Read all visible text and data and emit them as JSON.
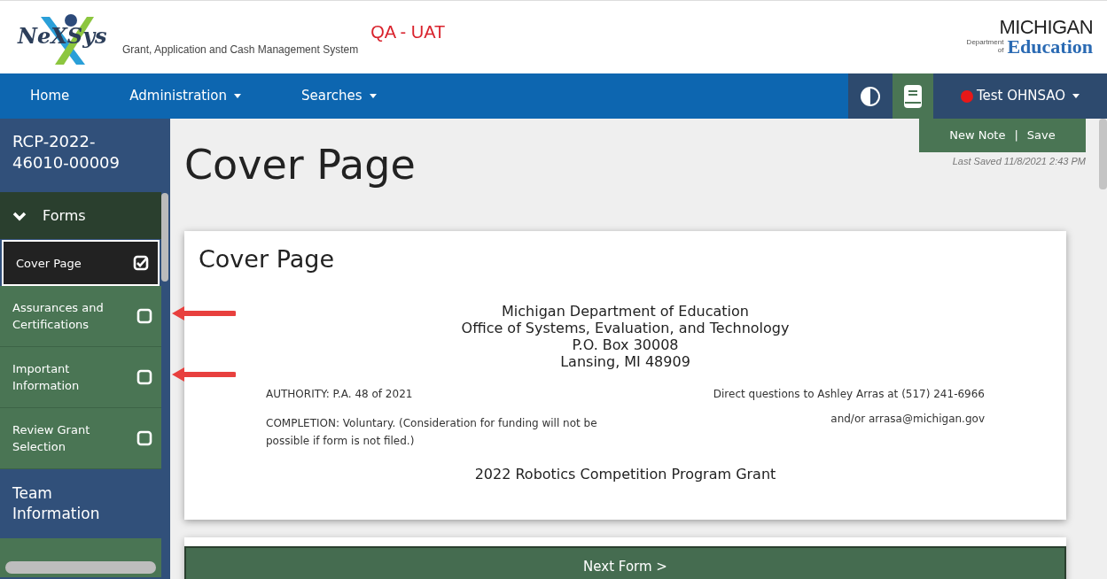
{
  "header": {
    "logo_text": "NeXSys",
    "subtitle": "Grant, Application and Cash Management System",
    "environment": "QA - UAT",
    "agency_logo": {
      "line_1": "MICHIGAN",
      "line_2_small": "Department of",
      "line_2": "Education"
    }
  },
  "nav": {
    "items": [
      {
        "label": "Home",
        "dropdown": false
      },
      {
        "label": "Administration",
        "dropdown": true
      },
      {
        "label": "Searches",
        "dropdown": true
      }
    ],
    "user": {
      "name": "Test OHNSAO"
    }
  },
  "sidebar": {
    "record_id": "RCP-2022-46010-00009",
    "section": {
      "label": "Forms",
      "expanded": true
    },
    "items": [
      {
        "kind": "form",
        "label": "Cover Page",
        "selected": true,
        "checked": true
      },
      {
        "kind": "form",
        "label": "Assurances and Certifications",
        "selected": false,
        "checked": false,
        "annotated": true
      },
      {
        "kind": "form",
        "label": "Important Information",
        "selected": false,
        "checked": false,
        "annotated": true
      },
      {
        "kind": "form",
        "label": "Review Grant Selection",
        "selected": false,
        "checked": false
      },
      {
        "kind": "section",
        "label": "Team Information",
        "selected": false
      },
      {
        "kind": "cut",
        "selected": false
      }
    ]
  },
  "actions": {
    "buttons": [
      "New Note",
      "Save"
    ],
    "separator": "|",
    "last_saved": "Last Saved 11/8/2021 2:43 PM"
  },
  "page_title": "Cover Page",
  "card": {
    "title": "Cover Page",
    "address": [
      "Michigan Department of Education",
      "Office of Systems, Evaluation, and Technology",
      "P.O. Box 30008",
      "Lansing, MI 48909"
    ],
    "authority": "AUTHORITY: P.A. 48 of 2021",
    "contact": "Direct questions to Ashley Arras at (517) 241-6966",
    "completion": "COMPLETION: Voluntary. (Consideration for funding will not be possible if form is not filed.)",
    "email": "and/or arrasa@michigan.gov",
    "program": "2022 Robotics Competition Program Grant"
  },
  "next_button": "Next Form >"
}
